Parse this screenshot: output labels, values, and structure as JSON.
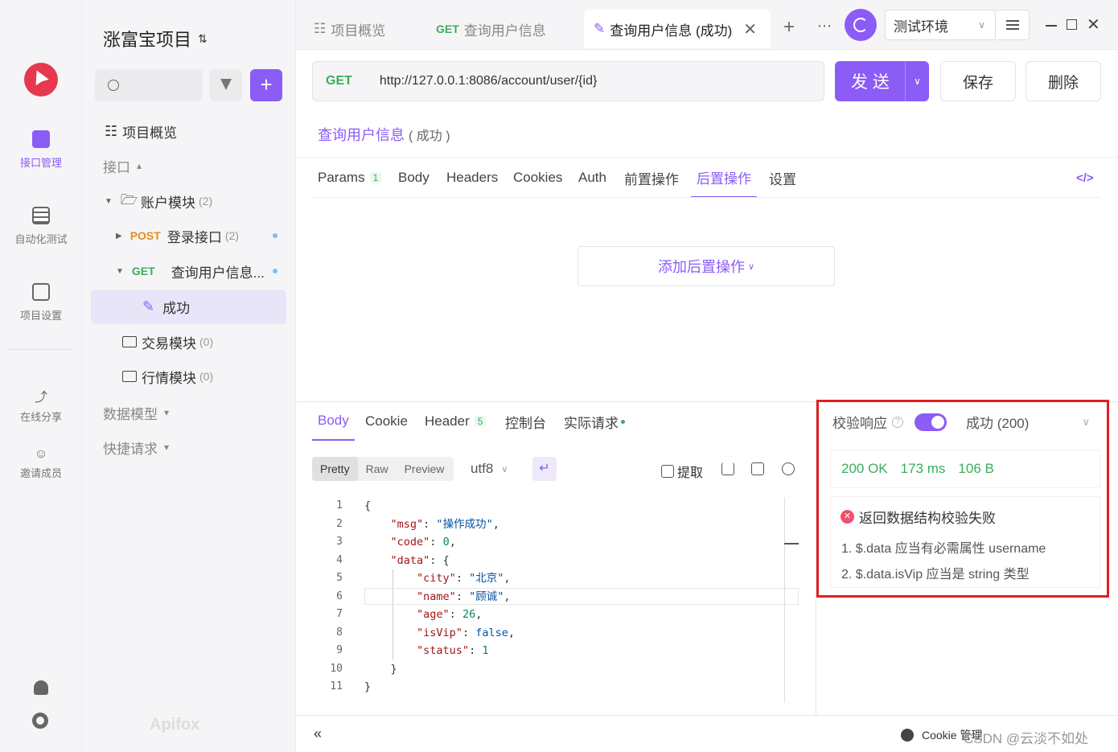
{
  "rail": {
    "items": [
      {
        "label": "接口管理"
      },
      {
        "label": "自动化测试"
      },
      {
        "label": "项目设置"
      },
      {
        "label": "在线分享"
      },
      {
        "label": "邀请成员"
      }
    ]
  },
  "sidebar": {
    "project_title": "涨富宝项目",
    "overview": "项目概览",
    "interfaces_header": "接口",
    "account_module": "账户模块",
    "account_count": "(2)",
    "login_method": "POST",
    "login_name": "登录接口",
    "login_count": "(2)",
    "query_method": "GET",
    "query_name": "查询用户信息...",
    "success_case": "成功",
    "trade_module": "交易模块",
    "trade_count": "(0)",
    "market_module": "行情模块",
    "market_count": "(0)",
    "data_models": "数据模型",
    "quick_requests": "快捷请求",
    "watermark": "Apifox"
  },
  "tabs": {
    "overview": "项目概览",
    "query_method": "GET",
    "query": "查询用户信息",
    "active": "查询用户信息 (成功)"
  },
  "env": {
    "name": "测试环境"
  },
  "request": {
    "method": "GET",
    "url": "http://127.0.0.1:8086/account/user/{id}",
    "send": "发 送",
    "save": "保存",
    "delete": "删除",
    "name": "查询用户信息",
    "case": "( 成功 )",
    "tabs": [
      {
        "label": "Params",
        "badge": "1"
      },
      {
        "label": "Body"
      },
      {
        "label": "Headers"
      },
      {
        "label": "Cookies"
      },
      {
        "label": "Auth"
      },
      {
        "label": "前置操作"
      },
      {
        "label": "后置操作"
      },
      {
        "label": "设置"
      }
    ],
    "add_post_op": "添加后置操作"
  },
  "response": {
    "tabs": [
      {
        "label": "Body"
      },
      {
        "label": "Cookie"
      },
      {
        "label": "Header",
        "badge": "5"
      },
      {
        "label": "控制台"
      },
      {
        "label": "实际请求"
      }
    ],
    "formats": [
      "Pretty",
      "Raw",
      "Preview"
    ],
    "encoding": "utf8",
    "extract": "提取",
    "lines": [
      "1",
      "2",
      "3",
      "4",
      "5",
      "6",
      "7",
      "8",
      "9",
      "10",
      "11"
    ],
    "json": {
      "msg": "操作成功",
      "code": "0",
      "city": "北京",
      "name": "顾诚",
      "age": "26",
      "isVip": "false",
      "status": "1"
    }
  },
  "validation": {
    "label": "校验响应",
    "case": "成功 (200)",
    "status": "200 OK",
    "time": "173 ms",
    "size": "106 B",
    "error_title": "返回数据结构校验失败",
    "errors": [
      "1. $.data 应当有必需属性 username",
      "2. $.data.isVip 应当是 string 类型"
    ]
  },
  "footer": {
    "cookie": "Cookie 管理",
    "watermark": "CSDN @云淡不如处"
  }
}
